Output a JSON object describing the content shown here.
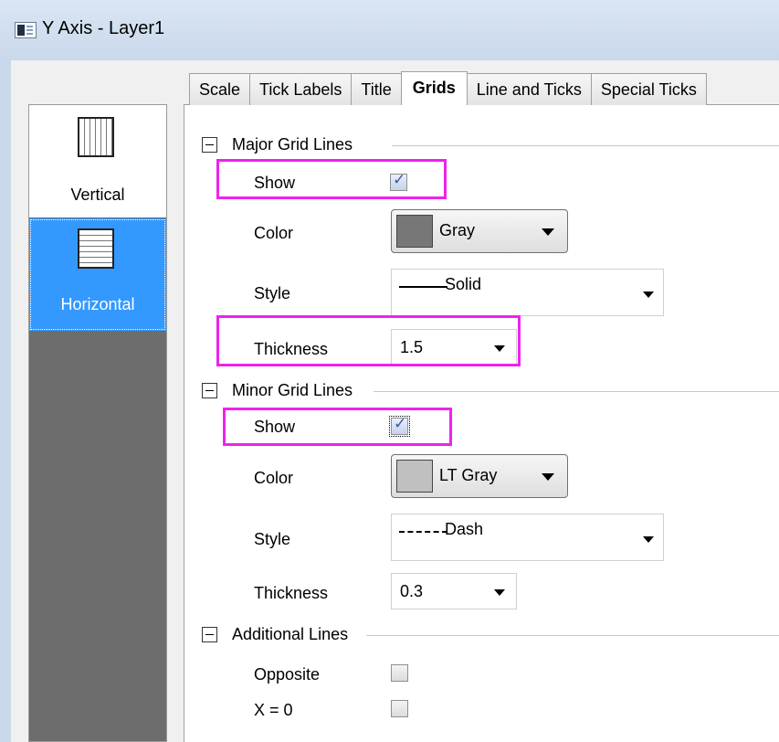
{
  "window": {
    "title": "Y Axis - Layer1"
  },
  "tabs": [
    {
      "label": "Scale",
      "active": false
    },
    {
      "label": "Tick Labels",
      "active": false
    },
    {
      "label": "Title",
      "active": false
    },
    {
      "label": "Grids",
      "active": true
    },
    {
      "label": "Line and Ticks",
      "active": false
    },
    {
      "label": "Special Ticks",
      "active": false
    }
  ],
  "left_panel": {
    "items": [
      {
        "label": "Vertical",
        "icon": "vertical-grid-icon",
        "selected": false
      },
      {
        "label": "Horizontal",
        "icon": "horizontal-grid-icon",
        "selected": true
      }
    ]
  },
  "major": {
    "title": "Major Grid Lines",
    "show_label": "Show",
    "show_checked": true,
    "color_label": "Color",
    "color_value": "Gray",
    "color_swatch": "#777777",
    "style_label": "Style",
    "style_value": "Solid",
    "thickness_label": "Thickness",
    "thickness_value": "1.5"
  },
  "minor": {
    "title": "Minor Grid Lines",
    "show_label": "Show",
    "show_checked": true,
    "color_label": "Color",
    "color_value": "LT Gray",
    "color_swatch": "#c0c0c0",
    "style_label": "Style",
    "style_value": "Dash",
    "thickness_label": "Thickness",
    "thickness_value": "0.3"
  },
  "additional": {
    "title": "Additional Lines",
    "opposite_label": "Opposite",
    "opposite_checked": false,
    "x0_label": "X = 0",
    "x0_checked": false
  },
  "colors": {
    "highlight": "#ee22ee",
    "selection": "#3399ff",
    "panel_bg": "#6d6d6d"
  }
}
